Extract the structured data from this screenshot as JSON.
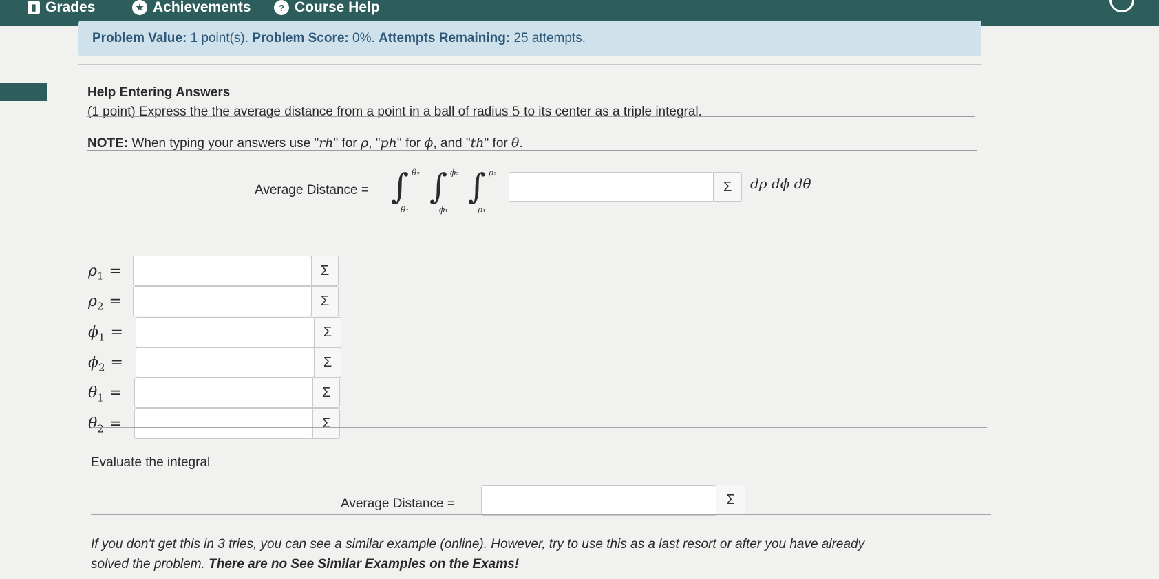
{
  "nav": {
    "grades": "Grades",
    "achievements": "Achievements",
    "course_help": "Course Help",
    "grades_icon": "bar-chart-icon",
    "achievements_icon": "star-icon",
    "help_icon": "question-icon"
  },
  "banner": {
    "value_label": "Problem Value:",
    "value_text": "1 point(s).",
    "score_label": "Problem Score:",
    "score_text": "0%.",
    "attempts_label": "Attempts Remaining:",
    "attempts_text": "25 attempts."
  },
  "problem": {
    "help_title": "Help Entering Answers",
    "statement_prefix": "(1 point) Express the the average distance from a point in a ball of radius",
    "radius": "5",
    "statement_suffix": "to its center as a triple integral.",
    "note_label": "NOTE:",
    "note_text_1": "When typing your answers use \"",
    "note_rh": "rh",
    "note_text_2": "\" for ",
    "note_rho": "ρ",
    "note_text_3": ", \"",
    "note_ph": "ph",
    "note_text_4": "\" for ",
    "note_phi": "ϕ",
    "note_text_5": ", and \"",
    "note_th": "th",
    "note_text_6": "\" for ",
    "note_theta": "θ",
    "note_text_7": "."
  },
  "integral": {
    "label": "Average Distance =",
    "integral_sign": "∫",
    "theta_upper": "θ₂",
    "theta_lower": "θ₁",
    "phi_upper": "ϕ₂",
    "phi_lower": "ϕ₁",
    "rho_upper": "ρ₂",
    "rho_lower": "ρ₁",
    "sigma": "Σ",
    "differentials": "dρ dϕ dθ"
  },
  "limits": [
    {
      "symbol": "ρ",
      "sub": "1",
      "eq": "=",
      "value": "",
      "sigma": "Σ"
    },
    {
      "symbol": "ρ",
      "sub": "2",
      "eq": "=",
      "value": "",
      "sigma": "Σ"
    },
    {
      "symbol": "ϕ",
      "sub": "1",
      "eq": "=",
      "value": "",
      "sigma": "Σ"
    },
    {
      "symbol": "ϕ",
      "sub": "2",
      "eq": "=",
      "value": "",
      "sigma": "Σ"
    },
    {
      "symbol": "θ",
      "sub": "1",
      "eq": "=",
      "value": "",
      "sigma": "Σ"
    },
    {
      "symbol": "θ",
      "sub": "2",
      "eq": "=",
      "value": "",
      "sigma": "Σ"
    }
  ],
  "evaluate": {
    "heading": "Evaluate the integral",
    "label": "Average Distance =",
    "value": "",
    "sigma": "Σ"
  },
  "footer": {
    "line1": "If you don't get this in 3 tries, you can see a similar example (online). However, try to use this as a last resort or after you have already",
    "line2_prefix": "solved the problem.",
    "line2_bold": "There are no See Similar Examples on the Exams!"
  }
}
